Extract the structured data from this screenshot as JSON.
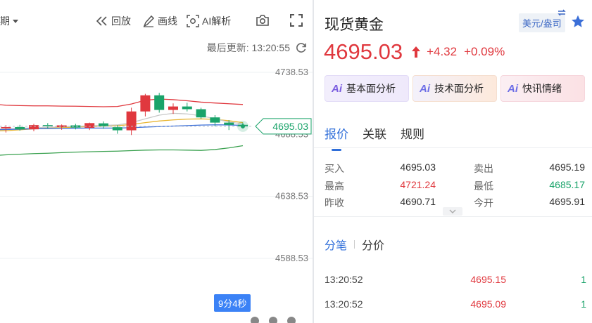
{
  "chart_toolbar": {
    "period": "期",
    "replay": "回放",
    "draw": "画线",
    "ai": "AI解析"
  },
  "last_update": {
    "label": "最后更新:",
    "time": "13:20:55"
  },
  "timer_badge": "9分4秒",
  "chart_data": {
    "type": "candlestick",
    "y_ticks": [
      "4738.53",
      "4688.53",
      "4638.53",
      "4588.53"
    ],
    "ylim": [
      4570,
      4750
    ],
    "current_price": "4695.03",
    "candles": [
      {
        "o": 4695.5,
        "h": 4697.0,
        "l": 4693.0,
        "c": 4694.8
      },
      {
        "o": 4695.2,
        "h": 4696.5,
        "l": 4692.5,
        "c": 4693.4
      },
      {
        "o": 4693.4,
        "h": 4696.0,
        "l": 4690.0,
        "c": 4694.4
      },
      {
        "o": 4694.4,
        "h": 4696.2,
        "l": 4691.5,
        "c": 4692.6
      },
      {
        "o": 4692.6,
        "h": 4697.0,
        "l": 4691.0,
        "c": 4696.0
      },
      {
        "o": 4696.0,
        "h": 4697.6,
        "l": 4693.4,
        "c": 4695.1
      },
      {
        "o": 4694.4,
        "h": 4696.5,
        "l": 4692.2,
        "c": 4695.8
      },
      {
        "o": 4695.8,
        "h": 4697.0,
        "l": 4692.5,
        "c": 4694.0
      },
      {
        "o": 4693.8,
        "h": 4698.0,
        "l": 4692.0,
        "c": 4697.6
      },
      {
        "o": 4697.4,
        "h": 4699.0,
        "l": 4693.0,
        "c": 4695.0
      },
      {
        "o": 4694.3,
        "h": 4696.0,
        "l": 4689.0,
        "c": 4691.8
      },
      {
        "o": 4691.8,
        "h": 4710.0,
        "l": 4688.0,
        "c": 4707.0
      },
      {
        "o": 4707.0,
        "h": 4721.2,
        "l": 4703.0,
        "c": 4720.0
      },
      {
        "o": 4720.0,
        "h": 4722.0,
        "l": 4706.0,
        "c": 4708.2
      },
      {
        "o": 4708.2,
        "h": 4713.5,
        "l": 4705.0,
        "c": 4711.0
      },
      {
        "o": 4711.0,
        "h": 4714.0,
        "l": 4707.0,
        "c": 4708.8
      },
      {
        "o": 4708.8,
        "h": 4710.0,
        "l": 4701.0,
        "c": 4702.2
      },
      {
        "o": 4702.2,
        "h": 4704.0,
        "l": 4695.0,
        "c": 4698.0
      },
      {
        "o": 4698.0,
        "h": 4700.0,
        "l": 4692.0,
        "c": 4696.2
      },
      {
        "o": 4696.2,
        "h": 4698.0,
        "l": 4693.4,
        "c": 4695.0
      }
    ],
    "ma_series": [
      {
        "color": "#e0383e",
        "values": [
          4713.5,
          4713.0,
          4712.0,
          4711.7,
          4711.5,
          4711.5,
          4711.3,
          4711.2,
          4711.0,
          4710.8,
          4711.0,
          4713.0,
          4716.0,
          4717.0,
          4716.5,
          4715.6,
          4714.5,
          4713.8,
          4713.2,
          4712.6
        ]
      },
      {
        "color": "#e8b530",
        "values": [
          4691.0,
          4691.2,
          4691.5,
          4692.2,
          4693.0,
          4693.5,
          4694.0,
          4694.4,
          4694.8,
          4695.2,
          4695.5,
          4696.5,
          4698.0,
          4699.3,
          4700.2,
          4700.8,
          4701.0,
          4700.6,
          4699.5,
          4698.0
        ]
      },
      {
        "color": "#c8c8c8",
        "values": [
          4692.6,
          4692.8,
          4693.0,
          4693.4,
          4693.8,
          4694.2,
          4694.6,
          4695.0,
          4695.4,
          4695.8,
          4696.1,
          4698.0,
          4701.0,
          4704.0,
          4705.5,
          4705.0,
          4703.5,
          4701.0,
          4698.5,
          4697.0
        ]
      },
      {
        "color": "#3b6fd8",
        "values": [
          4692.0,
          4692.2,
          4692.4,
          4692.7,
          4693.0,
          4693.2,
          4693.4,
          4693.5,
          4693.6,
          4693.6,
          4693.6,
          4693.9,
          4694.4,
          4694.8,
          4695.2,
          4695.6,
          4696.0,
          4696.2,
          4696.1,
          4695.8
        ]
      },
      {
        "color": "#3aa14f",
        "values": [
          4671.0,
          4671.4,
          4672.0,
          4672.5,
          4673.0,
          4673.3,
          4673.8,
          4674.2,
          4674.5,
          4674.8,
          4675.0,
          4675.4,
          4675.8,
          4676.0,
          4676.0,
          4675.8,
          4675.6,
          4676.3,
          4677.6,
          4679.4
        ]
      }
    ]
  },
  "instrument": {
    "name": "现货黄金",
    "currency_tag": "美元/盎司"
  },
  "price": {
    "last": "4695.03",
    "change_abs": "+4.32",
    "change_pct": "+0.09%"
  },
  "analysis_buttons": {
    "ai_glyph": "Ai",
    "fundamental": "基本面分析",
    "technical": "技术面分析",
    "news": "快讯情绪"
  },
  "main_tabs": {
    "quote": "报价",
    "related": "关联",
    "rules": "规则"
  },
  "quote_grid": {
    "bid_label": "买入",
    "bid": "4695.03",
    "ask_label": "卖出",
    "ask": "4695.19",
    "high_label": "最高",
    "high": "4721.24",
    "low_label": "最低",
    "low": "4685.17",
    "prev_close_label": "昨收",
    "prev_close": "4690.71",
    "open_label": "今开",
    "open": "4695.91"
  },
  "sub_tabs": {
    "ticks": "分笔",
    "price_dist": "分价"
  },
  "ticks": [
    {
      "time": "13:20:52",
      "price": "4695.15",
      "vol": "1"
    },
    {
      "time": "13:20:52",
      "price": "4695.09",
      "vol": "1"
    }
  ],
  "colors": {
    "up": "#e0383e",
    "down": "#1aa36a",
    "accent": "#2f6ed9"
  }
}
